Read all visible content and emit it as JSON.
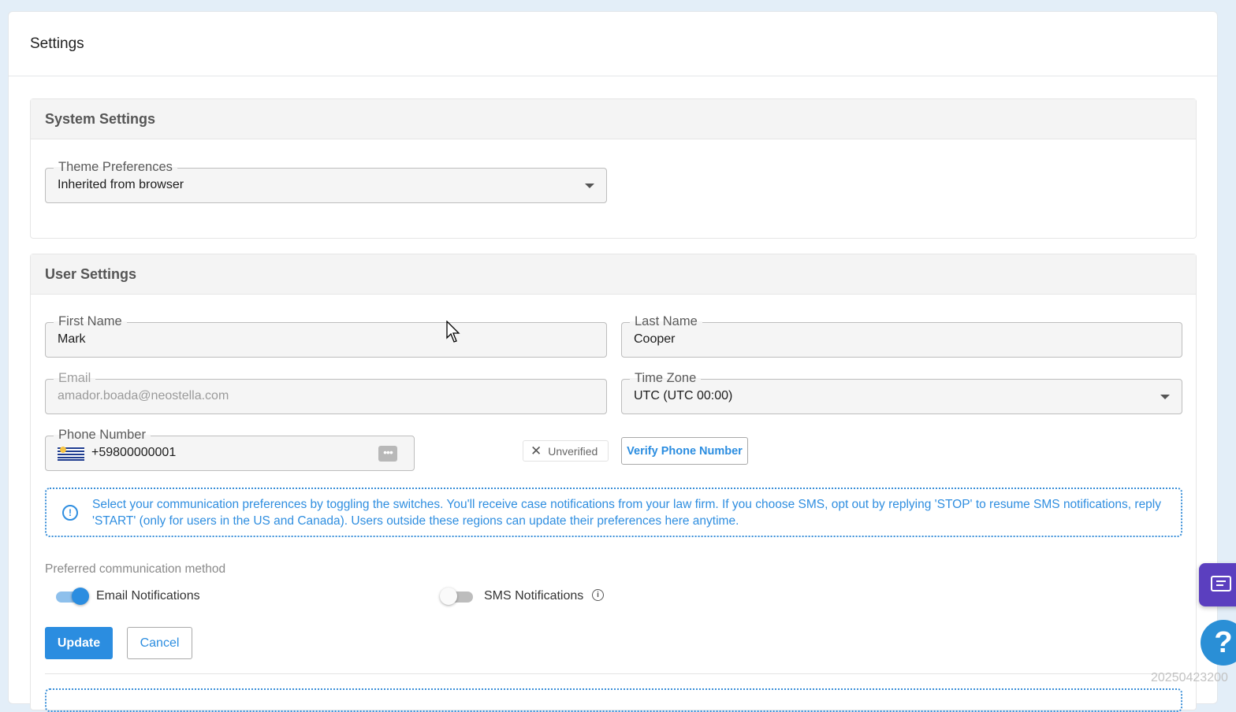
{
  "page": {
    "title": "Settings"
  },
  "system_settings": {
    "heading": "System Settings",
    "theme": {
      "label": "Theme Preferences",
      "value": "Inherited from browser"
    }
  },
  "user_settings": {
    "heading": "User Settings",
    "first_name": {
      "label": "First Name",
      "value": "Mark"
    },
    "last_name": {
      "label": "Last Name",
      "value": "Cooper"
    },
    "email": {
      "label": "Email",
      "value": "amador.boada@neostella.com"
    },
    "time_zone": {
      "label": "Time Zone",
      "value": "UTC (UTC 00:00)"
    },
    "phone": {
      "label": "Phone Number",
      "value": "+59800000001",
      "flag_icon": "uruguay-flag-icon"
    },
    "verification_status": "Unverified",
    "verify_button": "Verify Phone Number",
    "info_text": "Select your communication preferences by toggling the switches. You'll receive case notifications from your law firm. If you choose SMS, opt out by replying 'STOP' to resume SMS notifications, reply 'START' (only for users in the US and Canada). Users outside these regions can update their preferences here anytime.",
    "preferred_label": "Preferred communication method",
    "email_notifications": {
      "label": "Email Notifications",
      "enabled": true
    },
    "sms_notifications": {
      "label": "SMS Notifications",
      "enabled": false
    },
    "update_button": "Update",
    "cancel_button": "Cancel"
  },
  "build_stamp": "20250423200",
  "colors": {
    "primary": "#2b8de0",
    "chat": "#5b3fbf",
    "background": "#e3eef8"
  }
}
